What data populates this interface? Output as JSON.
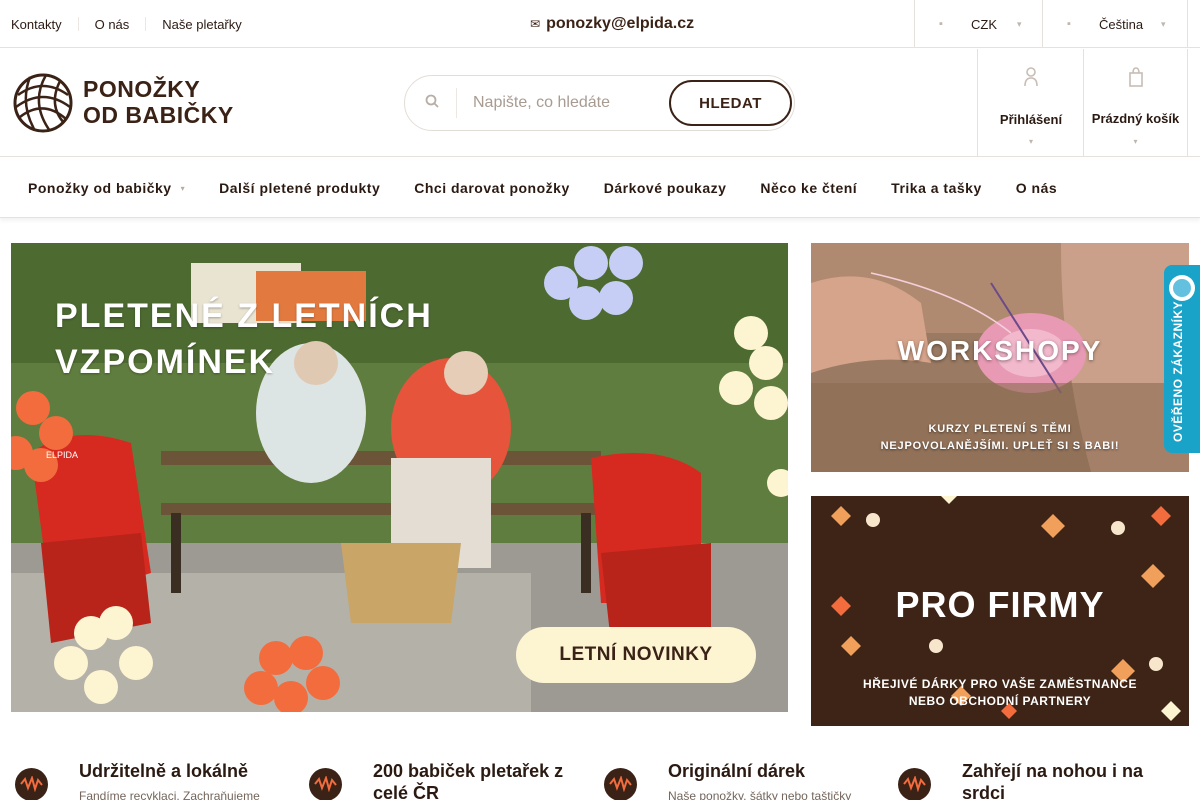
{
  "topbar": {
    "links": [
      "Kontakty",
      "O nás",
      "Naše pletařky"
    ],
    "email": "ponozky@elpida.cz",
    "currency": "CZK",
    "language": "Čeština"
  },
  "header": {
    "logo_line1": "PONOŽKY",
    "logo_line2": "OD BABIČKY",
    "search_placeholder": "Napište, co hledáte",
    "search_value": "",
    "search_button": "HLEDAT",
    "login_label": "Přihlášení",
    "cart_label": "Prázdný košík"
  },
  "nav": {
    "items": [
      "Ponožky od babičky",
      "Další pletené produkty",
      "Chci darovat ponožky",
      "Dárkové poukazy",
      "Něco ke čtení",
      "Trika a tašky",
      "O nás"
    ]
  },
  "banners": {
    "main_title_line1": "PLETENÉ Z LETNÍCH",
    "main_title_line2": "VZPOMÍNEK",
    "main_button": "LETNÍ NOVINKY",
    "main_chair_text": "ELPIDA",
    "side1_title": "WORKSHOPY",
    "side1_sub_line1": "KURZY PLETENÍ S TĚMI",
    "side1_sub_line2": "NEJPOVOLANĚJŠÍMI. UPLEŤ SI S BABI!",
    "side2_title": "PRO FIRMY",
    "side2_sub_line1": "HŘEJIVÉ DÁRKY PRO VAŠE ZAMĚSTNANCE",
    "side2_sub_line2": "NEBO OBCHODNÍ PARTNERY"
  },
  "badge": {
    "text": "OVĚŘENO ZÁKAZNÍKY"
  },
  "features": [
    {
      "title": "Udržitelně a lokálně",
      "desc": "Fandíme recyklaci. Zachraňujeme"
    },
    {
      "title": "200 babiček pletařek z celé ČR",
      "desc": ""
    },
    {
      "title": "Originální dárek",
      "desc": "Naše ponožky, šátky nebo taštičky"
    },
    {
      "title": "Zahřejí na nohou i na srdci",
      "desc": ""
    }
  ],
  "colors": {
    "brand_brown": "#3b2216",
    "badge_blue": "#1aa3c9",
    "banner_cream": "#fdf4d2"
  },
  "icons": {
    "email": "envelope-icon",
    "currency": "money-icon",
    "language": "globe-icon",
    "search": "search-icon",
    "login": "user-icon",
    "cart": "cart-icon",
    "feature": "yarn-wave-icon"
  }
}
